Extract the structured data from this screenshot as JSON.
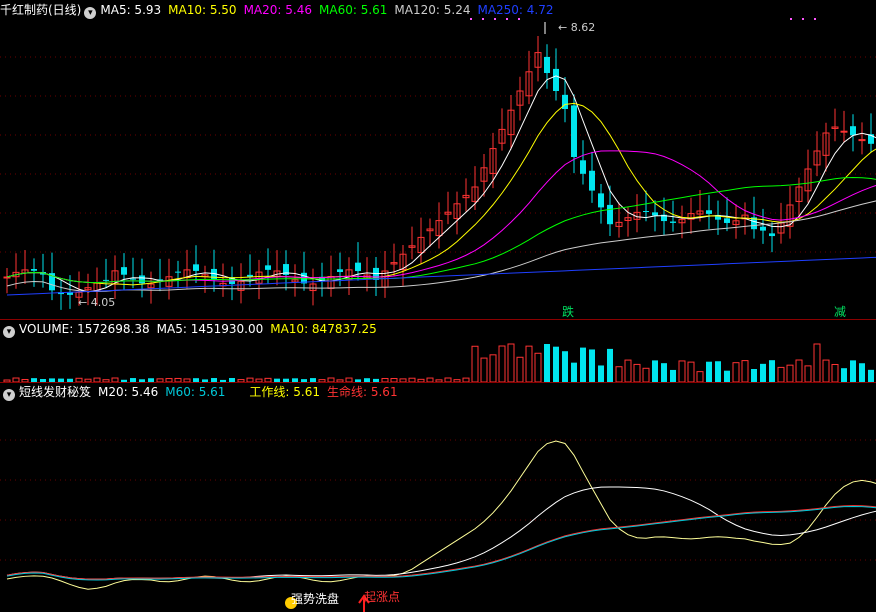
{
  "colors": {
    "background": "#000000",
    "up": "#ff3333",
    "down": "#00e5ee",
    "ma5": "#ffffff",
    "ma10": "#ffff00",
    "ma20": "#ff00ff",
    "ma60": "#00ff00",
    "ma120": "#cccccc",
    "ma250": "#1f3fff",
    "separator": "#8b0000"
  },
  "price_panel": {
    "title": "千红制药(日线)",
    "ma": [
      {
        "label": "MA5: 5.93",
        "color": "#ffffff"
      },
      {
        "label": "MA10: 5.50",
        "color": "#ffff00"
      },
      {
        "label": "MA20: 5.46",
        "color": "#ff00ff"
      },
      {
        "label": "MA60: 5.61",
        "color": "#00ff00"
      },
      {
        "label": "MA120: 5.24",
        "color": "#cccccc"
      },
      {
        "label": "MA250: 4.72",
        "color": "#1f3fff"
      }
    ],
    "high_marker": "8.62",
    "low_marker": "4.05",
    "signals": [
      "跌",
      "减"
    ]
  },
  "volume_panel": {
    "title": "VOLUME: 1572698.38",
    "ma5": "MA5: 1451930.00",
    "ma10": "MA10: 847837.25"
  },
  "indicator_panel": {
    "title": "短线发财秘笈",
    "m20": "M20: 5.46",
    "m60": "M60: 5.61",
    "work_line": "工作线: 5.61",
    "life_line": "生命线: 5.61",
    "annotations": [
      "强势洗盘",
      "起涨点"
    ]
  },
  "chart_data": {
    "type": "candlestick",
    "title": "千红制药(日线)",
    "high": 8.62,
    "low": 4.05,
    "ma_last": {
      "MA5": 5.93,
      "MA10": 5.5,
      "MA20": 5.46,
      "MA60": 5.61,
      "MA120": 5.24,
      "MA250": 4.72
    },
    "volume_last": 1572698.38,
    "volume_ma_last": {
      "MA5": 1451930.0,
      "MA10": 847837.25
    },
    "indicator_last": {
      "M20": 5.46,
      "M60": 5.61,
      "工作线": 5.61,
      "生命线": 5.61
    }
  }
}
